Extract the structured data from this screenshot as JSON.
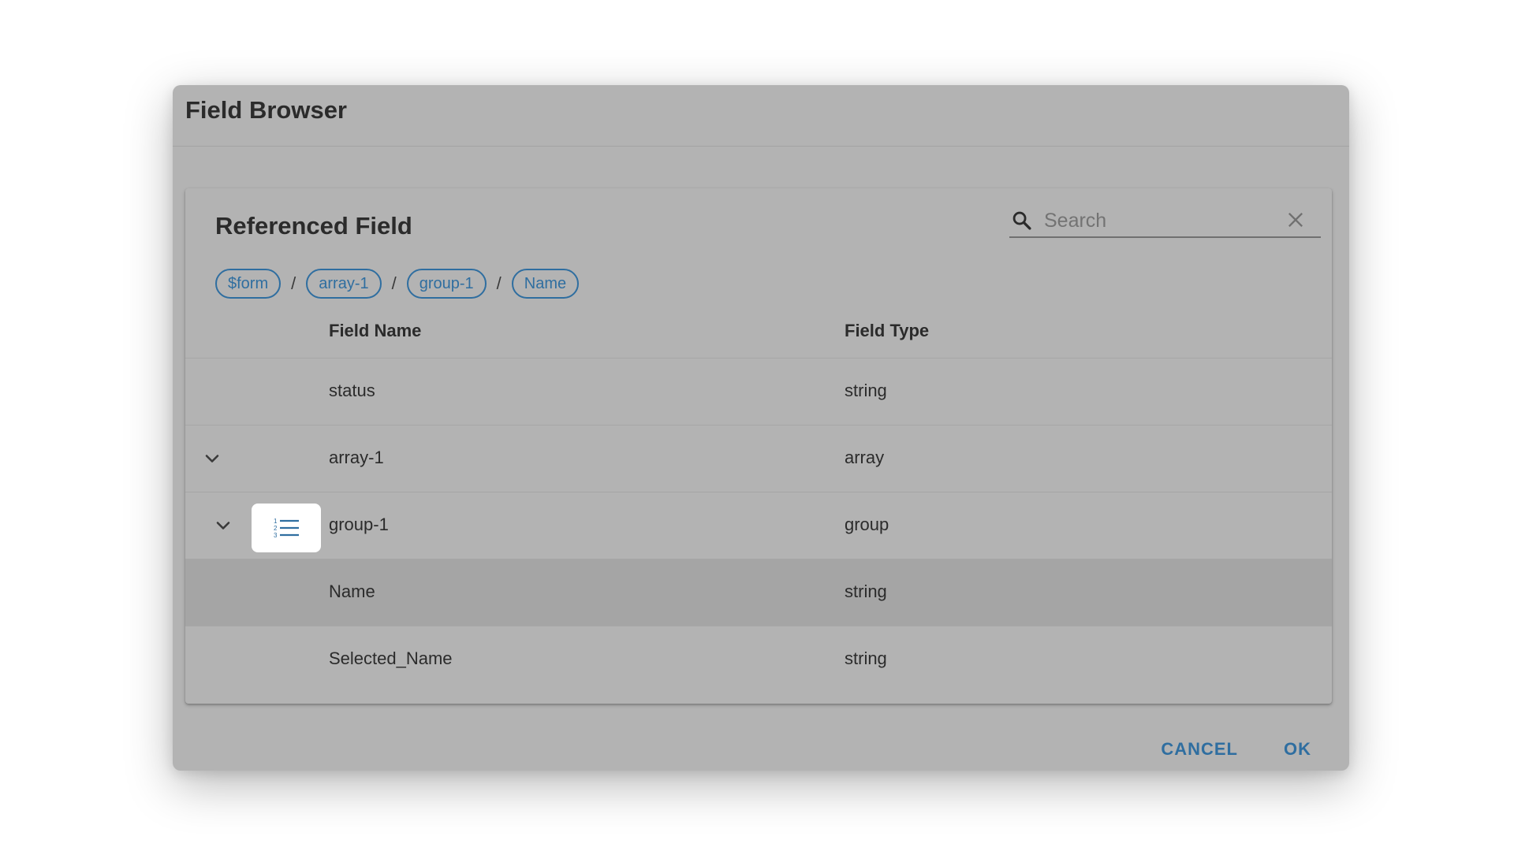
{
  "dialog": {
    "title": "Field Browser"
  },
  "panel": {
    "title": "Referenced Field",
    "search": {
      "placeholder": "Search",
      "value": ""
    }
  },
  "breadcrumb": [
    "$form",
    "array-1",
    "group-1",
    "Name"
  ],
  "breadcrumb_separator": "/",
  "table": {
    "columns": {
      "name": "Field Name",
      "type": "Field Type"
    },
    "rows": [
      {
        "name": "status",
        "type": "string"
      },
      {
        "name": "array-1",
        "type": "array"
      },
      {
        "name": "group-1",
        "type": "group"
      },
      {
        "name": "Name",
        "type": "string"
      },
      {
        "name": "Selected_Name",
        "type": "string"
      }
    ]
  },
  "actions": {
    "cancel": "CANCEL",
    "ok": "OK"
  },
  "colors": {
    "accent": "#2f6ea0",
    "dialog_bg": "#b3b3b3",
    "selected_row_bg": "#a5a5a5"
  },
  "icons": {
    "search": "search-icon",
    "clear": "close-icon",
    "expand": "chevron-down-icon",
    "group": "numbered-list-icon"
  }
}
